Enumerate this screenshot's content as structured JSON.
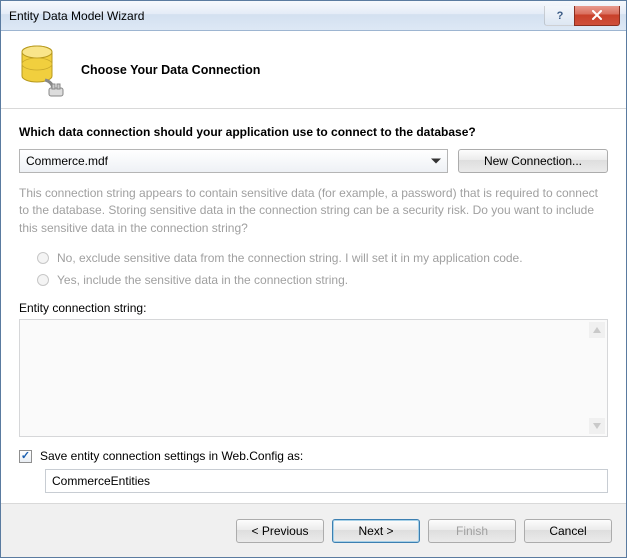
{
  "window": {
    "title": "Entity Data Model Wizard"
  },
  "header": {
    "step_title": "Choose Your Data Connection"
  },
  "content": {
    "question": "Which data connection should your application use to connect to the database?",
    "connection_combo_value": "Commerce.mdf",
    "new_connection_label": "New Connection...",
    "sensitive_warning": "This connection string appears to contain sensitive data (for example, a password) that is required to connect to the database. Storing sensitive data in the connection string can be a security risk. Do you want to include this sensitive data in the connection string?",
    "radio_exclude": "No, exclude sensitive data from the connection string. I will set it in my application code.",
    "radio_include": "Yes, include the sensitive data in the connection string.",
    "conn_string_label": "Entity connection string:",
    "conn_string_value": "",
    "save_checkbox_label": "Save entity connection settings in Web.Config as:",
    "save_checkbox_checked": true,
    "save_name_value": "CommerceEntities"
  },
  "footer": {
    "previous": "< Previous",
    "next": "Next >",
    "finish": "Finish",
    "cancel": "Cancel"
  }
}
